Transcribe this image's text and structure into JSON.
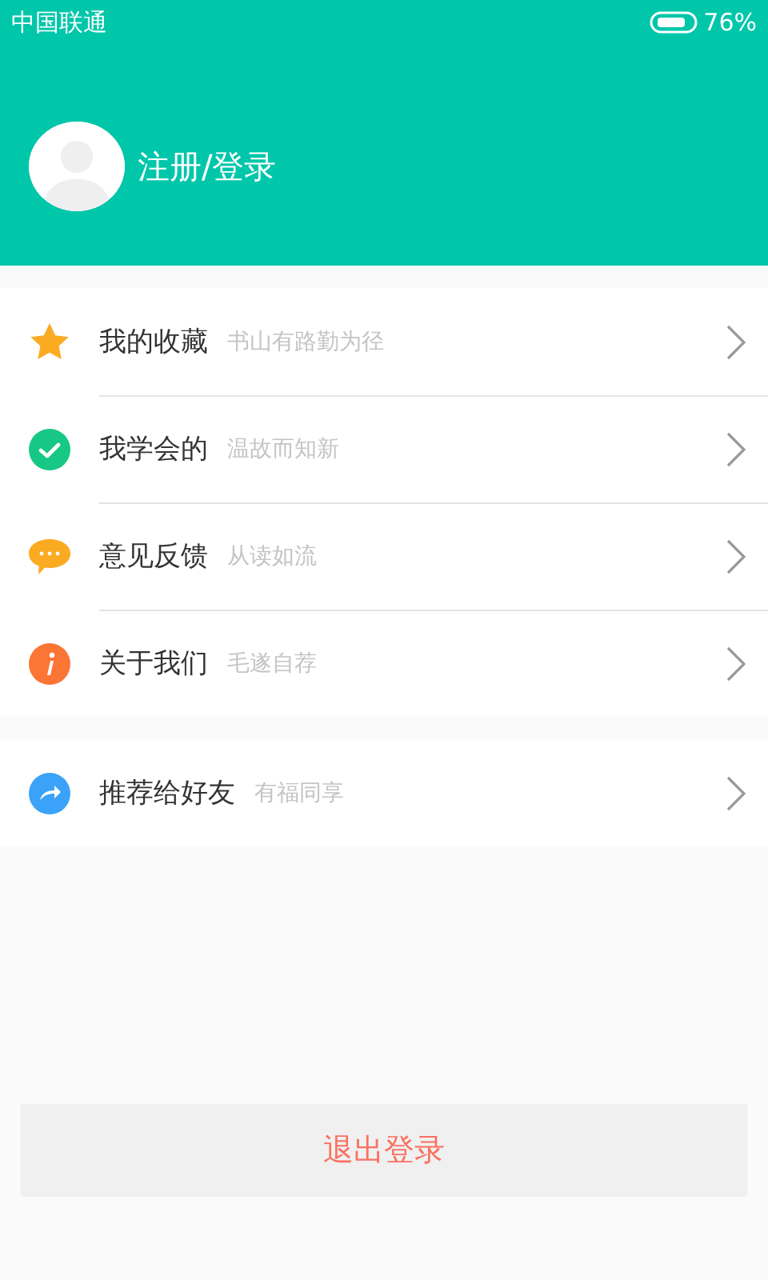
{
  "status_bar": {
    "carrier": "中国联通",
    "battery": "76%"
  },
  "profile": {
    "label": "注册/登录"
  },
  "menu_groups": [
    {
      "items": [
        {
          "kind": "star",
          "title": "我的收藏",
          "subtitle": "书山有路勤为径"
        },
        {
          "kind": "check",
          "title": "我学会的",
          "subtitle": "温故而知新"
        },
        {
          "kind": "chat",
          "title": "意见反馈",
          "subtitle": "从读如流"
        },
        {
          "kind": "info",
          "title": "关于我们",
          "subtitle": "毛遂自荐"
        }
      ]
    },
    {
      "items": [
        {
          "kind": "share",
          "title": "推荐给好友",
          "subtitle": "有福同享"
        }
      ]
    }
  ],
  "logout_button": "退出登录"
}
